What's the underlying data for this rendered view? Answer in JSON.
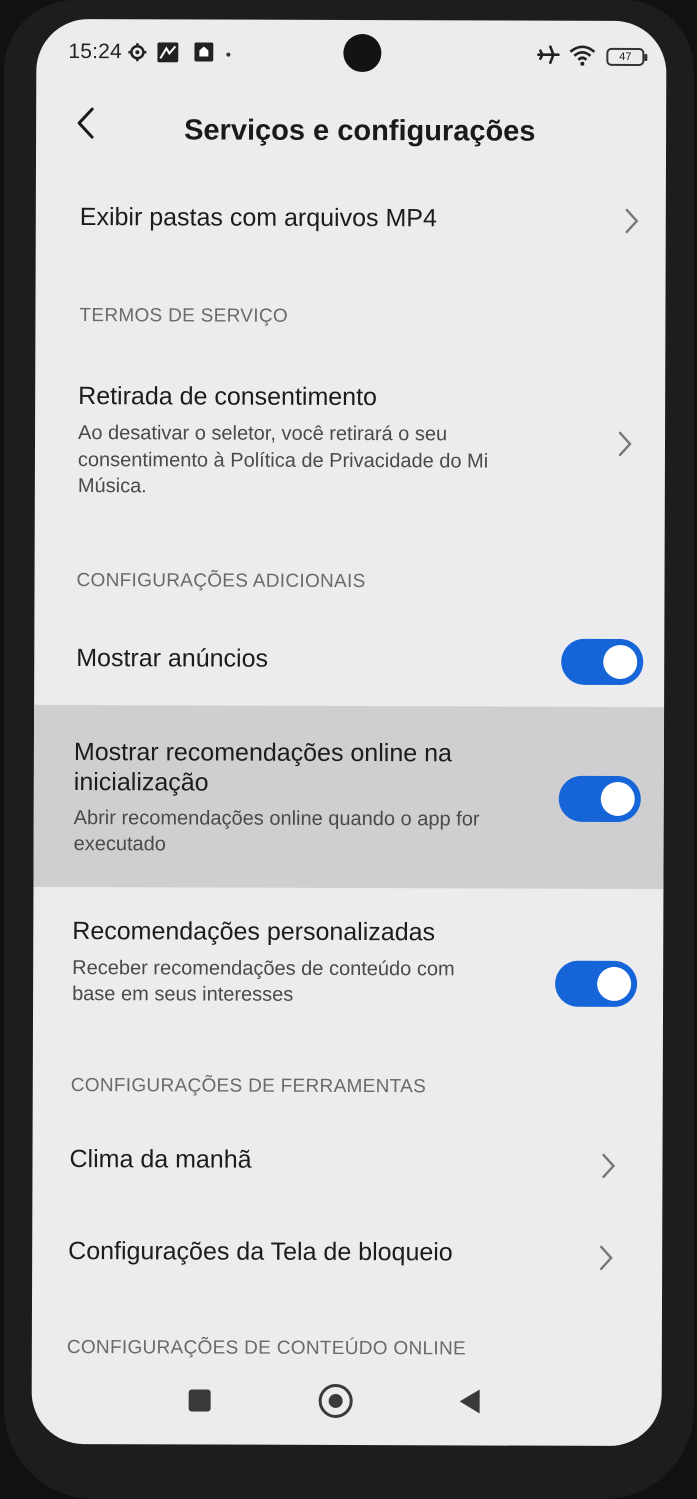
{
  "status_bar": {
    "time": "15:24",
    "icons": [
      "gear-icon",
      "notification-icon",
      "app-icon",
      "dot-icon",
      "airplane-icon",
      "wifi-icon"
    ],
    "battery": "47"
  },
  "header": {
    "title": "Serviços e configurações"
  },
  "items": {
    "mp4_folders": {
      "title": "Exibir pastas com arquivos MP4"
    },
    "section_terms": "TERMOS DE SERVIÇO",
    "consent": {
      "title": "Retirada de consentimento",
      "subtitle_line1": "Ao desativar o seletor, você retirará o seu",
      "subtitle_line2": "consentimento à Política de Privacidade do Mi",
      "subtitle_line3": "Música."
    },
    "section_additional": "CONFIGURAÇÕES ADICIONAIS",
    "show_ads": {
      "title": "Mostrar anúncios",
      "enabled": true
    },
    "online_recs": {
      "title_line1": "Mostrar recomendações online na",
      "title_line2": "inicialização",
      "subtitle_line1": "Abrir recomendações online quando o app for",
      "subtitle_line2": "executado",
      "enabled": true
    },
    "personalized_recs": {
      "title": "Recomendações personalizadas",
      "subtitle_line1": "Receber recomendações de conteúdo com",
      "subtitle_line2": "base em seus interesses",
      "enabled": true
    },
    "section_tools": "CONFIGURAÇÕES DE FERRAMENTAS",
    "morning_weather": {
      "title": "Clima da manhã"
    },
    "lockscreen": {
      "title": "Configurações da Tela de bloqueio"
    },
    "section_online": "CONFIGURAÇÕES DE CONTEÚDO ONLINE"
  },
  "colors": {
    "toggle_on": "#1565d8",
    "background": "#ececee",
    "highlight": "#cfcfd1"
  }
}
